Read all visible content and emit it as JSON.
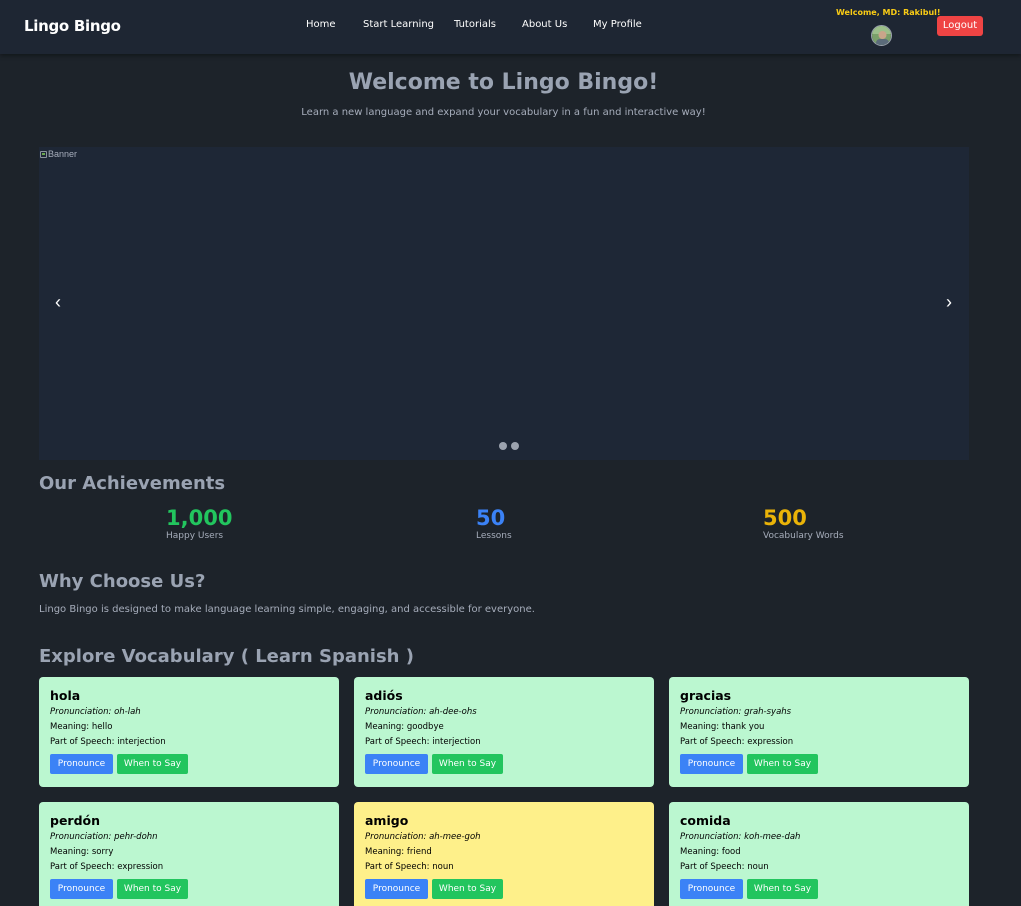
{
  "navbar": {
    "brand": "Lingo Bingo",
    "links": [
      "Home",
      "Start Learning",
      "Tutorials",
      "About Us",
      "My Profile"
    ],
    "welcome_text": "Welcome, MD: Rakibul!",
    "logout_label": "Logout"
  },
  "hero": {
    "title": "Welcome to Lingo Bingo!",
    "subtitle": "Learn a new language and expand your vocabulary in a fun and interactive way!"
  },
  "carousel": {
    "banner_alt": "Banner",
    "prev_icon": "‹",
    "next_icon": "›"
  },
  "achievements": {
    "heading": "Our Achievements",
    "stats": [
      {
        "value": "1,000",
        "label": "Happy Users",
        "color": "#22c55e"
      },
      {
        "value": "50",
        "label": "Lessons",
        "color": "#3b82f6"
      },
      {
        "value": "500",
        "label": "Vocabulary Words",
        "color": "#eab308"
      }
    ]
  },
  "why": {
    "heading": "Why Choose Us?",
    "text": "Lingo Bingo is designed to make language learning simple, engaging, and accessible for everyone."
  },
  "vocab": {
    "heading": "Explore Vocabulary ( Learn Spanish )",
    "pronounce_label": "Pronounce",
    "when_label": "When to Say",
    "cards": [
      {
        "word": "hola",
        "pronunciation": "Pronunciation: oh-lah",
        "meaning": "Meaning: hello",
        "pos": "Part of Speech: interjection",
        "bg": "#bbf7d0"
      },
      {
        "word": "adiós",
        "pronunciation": "Pronunciation: ah-dee-ohs",
        "meaning": "Meaning: goodbye",
        "pos": "Part of Speech: interjection",
        "bg": "#bbf7d0"
      },
      {
        "word": "gracias",
        "pronunciation": "Pronunciation: grah-syahs",
        "meaning": "Meaning: thank you",
        "pos": "Part of Speech: expression",
        "bg": "#bbf7d0"
      },
      {
        "word": "perdón",
        "pronunciation": "Pronunciation: pehr-dohn",
        "meaning": "Meaning: sorry",
        "pos": "Part of Speech: expression",
        "bg": "#bbf7d0"
      },
      {
        "word": "amigo",
        "pronunciation": "Pronunciation: ah-mee-goh",
        "meaning": "Meaning: friend",
        "pos": "Part of Speech: noun",
        "bg": "#fef08a"
      },
      {
        "word": "comida",
        "pronunciation": "Pronunciation: koh-mee-dah",
        "meaning": "Meaning: food",
        "pos": "Part of Speech: noun",
        "bg": "#bbf7d0"
      }
    ]
  }
}
